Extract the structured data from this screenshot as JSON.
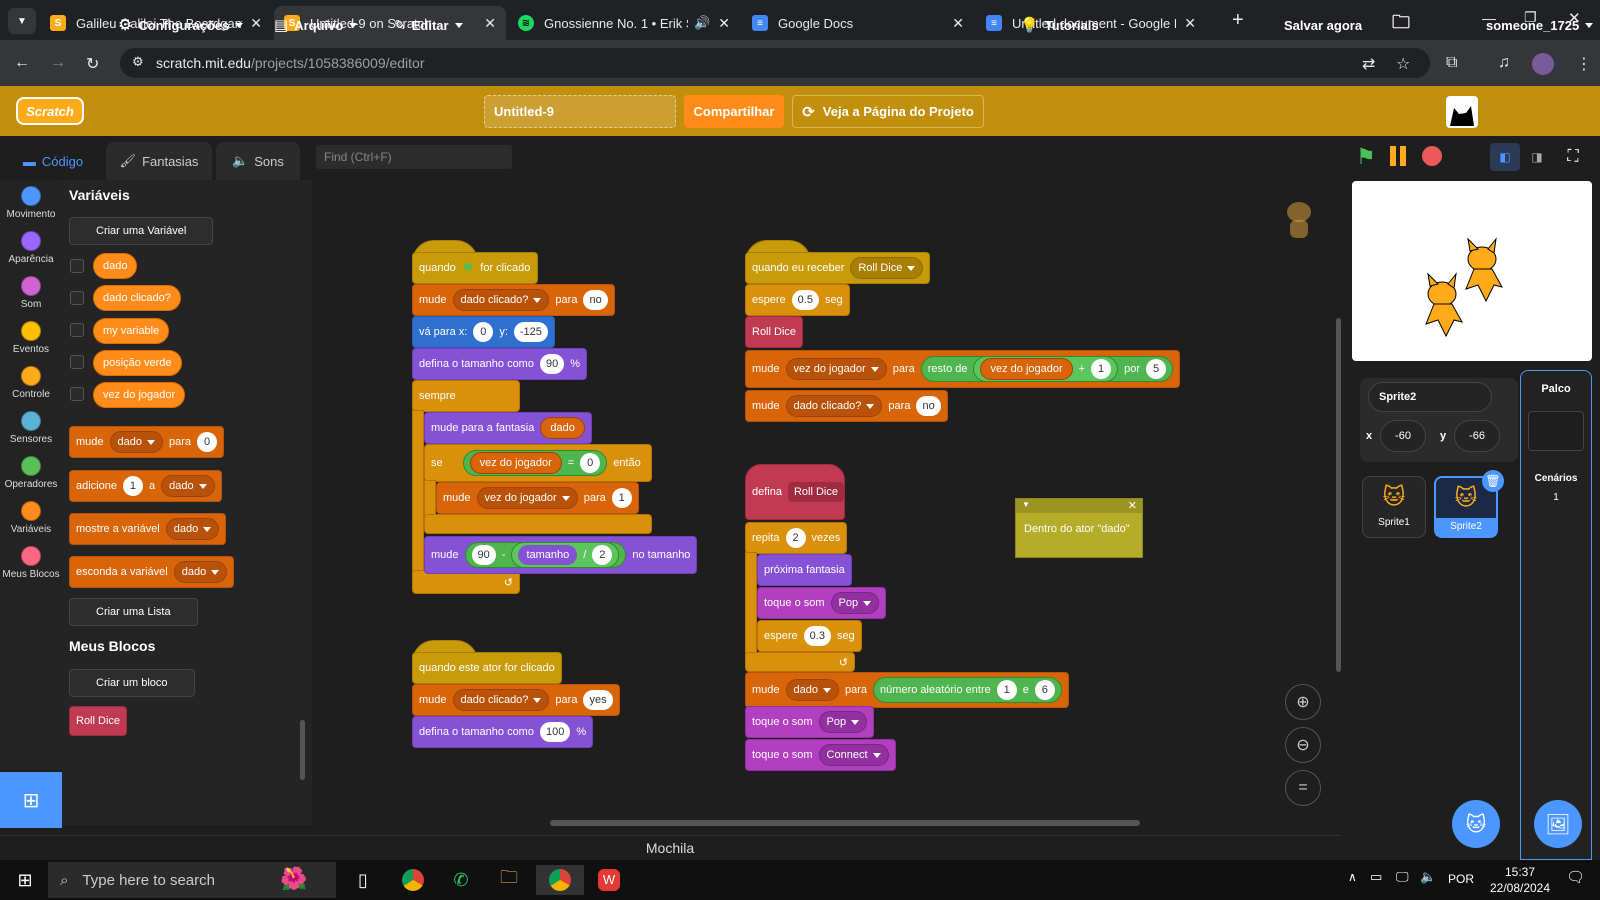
{
  "browser": {
    "tabs": [
      {
        "title": "Galileu Galilei The Boardgame (",
        "active": false
      },
      {
        "title": "Untitled-9 on Scratch",
        "active": true
      },
      {
        "title": "Gnossienne No. 1 • Erik Sati",
        "active": false
      },
      {
        "title": "Google Docs",
        "active": false
      },
      {
        "title": "Untitled document - Google Do",
        "active": false
      }
    ],
    "url_host": "scratch.mit.edu",
    "url_path": "/projects/1058386009/editor"
  },
  "menubar": {
    "logo": "Scratch",
    "settings": "Configurações",
    "file": "Arquivo",
    "edit": "Editar",
    "project_title": "Untitled-9",
    "share": "Compartilhar",
    "see_project": "Veja a Página do Projeto",
    "tutorials": "Tutoriais",
    "save_now": "Salvar agora",
    "username": "someone_1725"
  },
  "editor_tabs": {
    "code": "Código",
    "costumes": "Fantasias",
    "sounds": "Sons"
  },
  "find_placeholder": "Find (Ctrl+F)",
  "categories": [
    {
      "label": "Movimento",
      "color": "#4c97ff"
    },
    {
      "label": "Aparência",
      "color": "#9966ff"
    },
    {
      "label": "Som",
      "color": "#cf63cf"
    },
    {
      "label": "Eventos",
      "color": "#ffbf00"
    },
    {
      "label": "Controle",
      "color": "#ffab19"
    },
    {
      "label": "Sensores",
      "color": "#5cb1d6"
    },
    {
      "label": "Operadores",
      "color": "#59c059"
    },
    {
      "label": "Variáveis",
      "color": "#ff8c1a"
    },
    {
      "label": "Meus Blocos",
      "color": "#ff6680"
    }
  ],
  "palette": {
    "variables_heading": "Variáveis",
    "make_variable": "Criar uma Variável",
    "variables": [
      "dado",
      "dado clicado?",
      "my variable",
      "posição verde",
      "vez do jogador"
    ],
    "set_block": {
      "label": "mude",
      "var": "dado",
      "to": "para",
      "value": "0"
    },
    "change_block": {
      "label": "adicione",
      "value": "1",
      "a": "a",
      "var": "dado"
    },
    "show_block": {
      "label": "mostre a variável",
      "var": "dado"
    },
    "hide_block": {
      "label": "esconda a variável",
      "var": "dado"
    },
    "make_list": "Criar uma Lista",
    "myblocks_heading": "Meus Blocos",
    "make_block": "Criar um bloco",
    "custom_block": "Roll Dice"
  },
  "script1": {
    "hat": {
      "when": "quando",
      "clicked": "for clicado"
    },
    "set1": {
      "label": "mude",
      "var": "dado clicado?",
      "to": "para",
      "value": "no"
    },
    "goto": {
      "label": "vá para x:",
      "x": "0",
      "ylabel": "y:",
      "y": "-125"
    },
    "size": {
      "label": "defina o tamanho como",
      "value": "90",
      "unit": "%"
    },
    "forever": "sempre",
    "costume": {
      "label": "mude para a fantasia",
      "var": "dado"
    },
    "if": {
      "label": "se",
      "var": "vez do jogador",
      "op": "=",
      "value": "0",
      "then": "então"
    },
    "set2": {
      "label": "mude",
      "var": "vez do jogador",
      "to": "para",
      "value": "1"
    },
    "setsize": {
      "label": "mude",
      "a": "90",
      "minus": "-",
      "var": "tamanho",
      "div": "/",
      "b": "2",
      "suffix": "no tamanho"
    }
  },
  "script2": {
    "hat": "quando este ator for clicado",
    "set1": {
      "label": "mude",
      "var": "dado clicado?",
      "to": "para",
      "value": "yes"
    },
    "size": {
      "label": "defina o tamanho como",
      "value": "100",
      "unit": "%"
    }
  },
  "script3": {
    "hat": {
      "label": "quando eu receber",
      "msg": "Roll Dice"
    },
    "wait": {
      "label": "espere",
      "value": "0.5",
      "unit": "seg"
    },
    "call": "Roll Dice",
    "set1": {
      "label": "mude",
      "var": "vez do jogador",
      "to": "para",
      "mod": "resto de",
      "var2": "vez do jogador",
      "plus": "+",
      "a": "1",
      "por": "por",
      "b": "5"
    },
    "set2": {
      "label": "mude",
      "var": "dado clicado?",
      "to": "para",
      "value": "no"
    }
  },
  "script4": {
    "define": "defina",
    "name": "Roll Dice",
    "repeat": {
      "label": "repita",
      "value": "2",
      "unit": "vezes"
    },
    "next": "próxima fantasia",
    "play1": {
      "label": "toque o som",
      "sound": "Pop"
    },
    "wait": {
      "label": "espere",
      "value": "0.3",
      "unit": "seg"
    },
    "set": {
      "label": "mude",
      "var": "dado",
      "to": "para",
      "rand": "número aleatório entre",
      "a": "1",
      "e": "e",
      "b": "6"
    },
    "play2": {
      "label": "toque o som",
      "sound": "Pop"
    },
    "play3": {
      "label": "toque o som",
      "sound": "Connect"
    }
  },
  "note": "Dentro do ator \"dado\"",
  "sprite_info": {
    "name": "Sprite2",
    "x_label": "x",
    "x": "-60",
    "y_label": "y",
    "y": "-66"
  },
  "sprites": [
    "Sprite1",
    "Sprite2"
  ],
  "stage_panel": {
    "title": "Palco",
    "backdrops_label": "Cenários",
    "backdrops_count": "1"
  },
  "backpack": "Mochila",
  "taskbar": {
    "search_placeholder": "Type here to search",
    "lang": "POR",
    "time": "15:37",
    "date": "22/08/2024"
  }
}
